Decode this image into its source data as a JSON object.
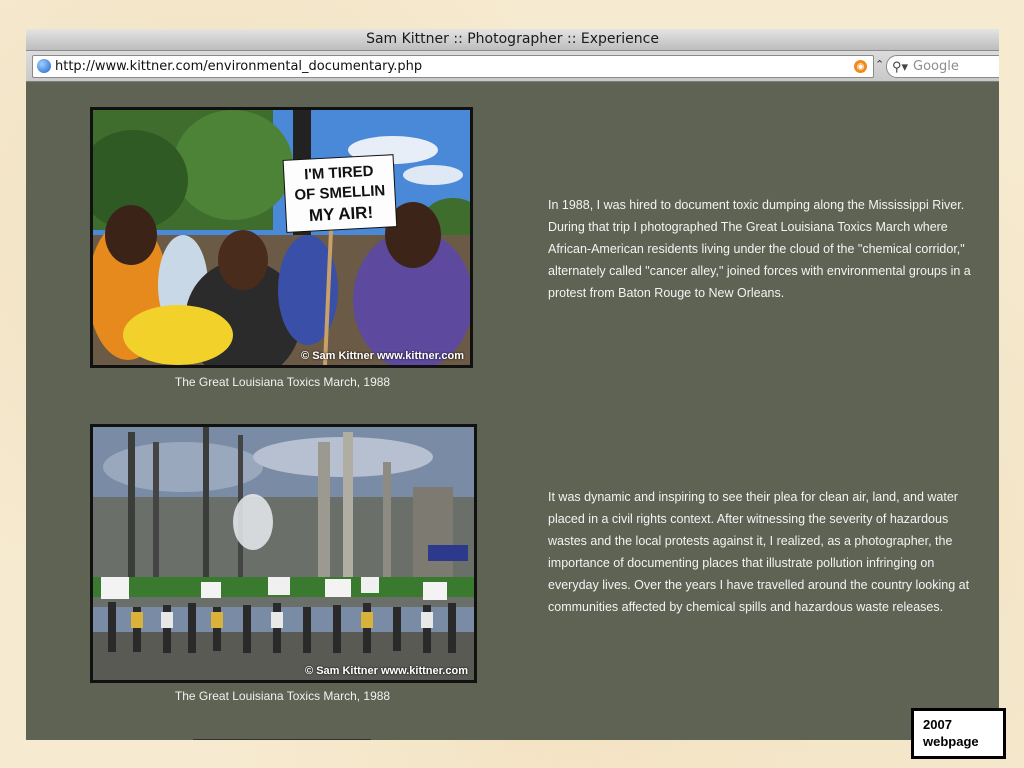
{
  "window": {
    "title": "Sam Kittner :: Photographer :: Experience",
    "url": "http://www.kittner.com/environmental_documentary.php",
    "search_placeholder": "Google"
  },
  "sections": [
    {
      "image_description": "Protesters marching; woman holds sign",
      "sign_text": "I'M TIRED OF SMELLIN MY AIR!",
      "credit": "© Sam Kittner www.kittner.com",
      "caption": "The Great Louisiana Toxics March, 1988",
      "paragraph": "In 1988, I was hired to document toxic dumping along the Mississippi River. During that trip I photographed The Great Louisiana Toxics March where African-American residents living under the cloud of the \"chemical corridor,\" alternately called \"cancer alley,\" joined forces with environmental groups in a protest from Baton Rouge to New Orleans."
    },
    {
      "image_description": "Marchers in front of chemical plant",
      "credit": "© Sam Kittner www.kittner.com",
      "caption": "The Great Louisiana Toxics March, 1988",
      "paragraph": "It was dynamic and inspiring to see their plea for clean air, land, and water placed in a civil rights context. After witnessing the severity of hazardous wastes and the local protests against it, I realized, as a photographer, the importance of documenting places that illustrate pollution infringing on everyday lives. Over the years I have travelled around the country looking at communities affected by chemical spills and hazardous waste releases."
    }
  ],
  "badge": {
    "line1": "2007",
    "line2": "webpage"
  },
  "icons": {
    "site": "globe-icon",
    "feed": "rss-icon",
    "search": "search-icon"
  },
  "colors": {
    "page_bg": "#5e6353",
    "slide_bg": "#f6ead0"
  }
}
